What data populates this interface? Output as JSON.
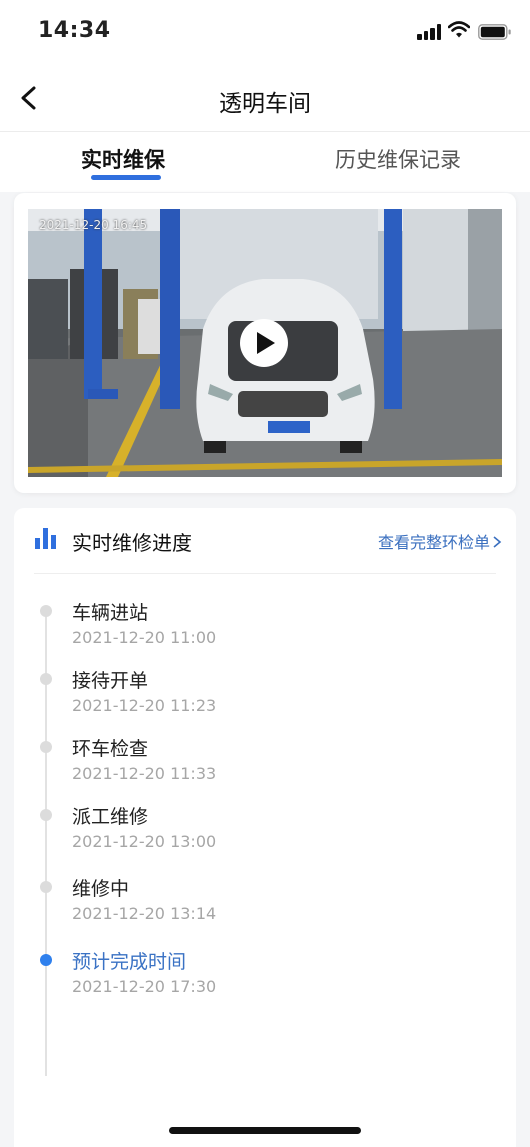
{
  "status_bar": {
    "time": "14:34",
    "icons": [
      "signal-icon",
      "wifi-icon",
      "battery-icon"
    ]
  },
  "nav": {
    "title": "透明车间",
    "back_icon": "chevron-left-icon"
  },
  "tabs": [
    {
      "label": "实时维保",
      "active": true
    },
    {
      "label": "历史维保记录",
      "active": false
    }
  ],
  "video": {
    "timestamp": "2021-12-20 16:45",
    "play_icon": "play-icon"
  },
  "progress": {
    "title": "实时维修进度",
    "icon": "bar-chart-icon",
    "link_label": "查看完整环检单",
    "steps": [
      {
        "name": "车辆进站",
        "time": "2021-12-20 11:00"
      },
      {
        "name": "接待开单",
        "time": "2021-12-20 11:23"
      },
      {
        "name": "环车检查",
        "time": "2021-12-20 11:33"
      },
      {
        "name": "派工维修",
        "time": "2021-12-20 13:00"
      },
      {
        "name": "维修中",
        "time": "2021-12-20 13:14"
      },
      {
        "name": "预计完成时间",
        "time": "2021-12-20 17:30",
        "active": true
      }
    ]
  },
  "colors": {
    "accent": "#2f6fde",
    "link": "#3a6fbf",
    "active_step": "#2f80ed"
  }
}
